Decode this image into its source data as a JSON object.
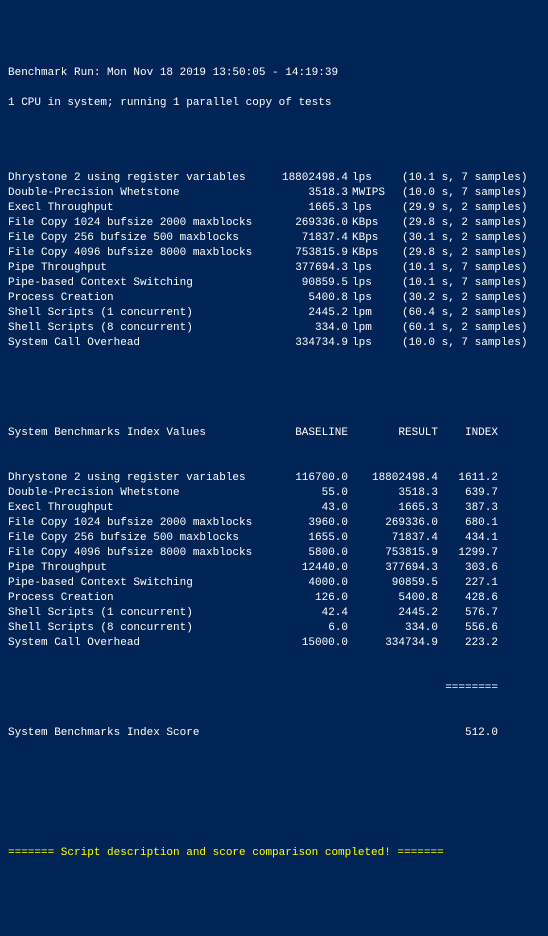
{
  "header": {
    "run_line": "Benchmark Run: Mon Nov 18 2019 13:50:05 - 14:19:39",
    "cpu_line": "1 CPU in system; running 1 parallel copy of tests"
  },
  "tests": [
    {
      "name": "Dhrystone 2 using register variables",
      "value": "18802498.4",
      "unit": "lps",
      "time": "10.1 s",
      "samples": "7 samples"
    },
    {
      "name": "Double-Precision Whetstone",
      "value": "3518.3",
      "unit": "MWIPS",
      "time": "10.0 s",
      "samples": "7 samples"
    },
    {
      "name": "Execl Throughput",
      "value": "1665.3",
      "unit": "lps",
      "time": "29.9 s",
      "samples": "2 samples"
    },
    {
      "name": "File Copy 1024 bufsize 2000 maxblocks",
      "value": "269336.0",
      "unit": "KBps",
      "time": "29.8 s",
      "samples": "2 samples"
    },
    {
      "name": "File Copy 256 bufsize 500 maxblocks",
      "value": "71837.4",
      "unit": "KBps",
      "time": "30.1 s",
      "samples": "2 samples"
    },
    {
      "name": "File Copy 4096 bufsize 8000 maxblocks",
      "value": "753815.9",
      "unit": "KBps",
      "time": "29.8 s",
      "samples": "2 samples"
    },
    {
      "name": "Pipe Throughput",
      "value": "377694.3",
      "unit": "lps",
      "time": "10.1 s",
      "samples": "7 samples"
    },
    {
      "name": "Pipe-based Context Switching",
      "value": "90859.5",
      "unit": "lps",
      "time": "10.1 s",
      "samples": "7 samples"
    },
    {
      "name": "Process Creation",
      "value": "5400.8",
      "unit": "lps",
      "time": "30.2 s",
      "samples": "2 samples"
    },
    {
      "name": "Shell Scripts (1 concurrent)",
      "value": "2445.2",
      "unit": "lpm",
      "time": "60.4 s",
      "samples": "2 samples"
    },
    {
      "name": "Shell Scripts (8 concurrent)",
      "value": "334.0",
      "unit": "lpm",
      "time": "60.1 s",
      "samples": "2 samples"
    },
    {
      "name": "System Call Overhead",
      "value": "334734.9",
      "unit": "lps",
      "time": "10.0 s",
      "samples": "7 samples"
    }
  ],
  "index_header": {
    "title": "System Benchmarks Index Values",
    "baseline": "BASELINE",
    "result": "RESULT",
    "index": "INDEX"
  },
  "indices": [
    {
      "name": "Dhrystone 2 using register variables",
      "baseline": "116700.0",
      "result": "18802498.4",
      "index": "1611.2"
    },
    {
      "name": "Double-Precision Whetstone",
      "baseline": "55.0",
      "result": "3518.3",
      "index": "639.7"
    },
    {
      "name": "Execl Throughput",
      "baseline": "43.0",
      "result": "1665.3",
      "index": "387.3"
    },
    {
      "name": "File Copy 1024 bufsize 2000 maxblocks",
      "baseline": "3960.0",
      "result": "269336.0",
      "index": "680.1"
    },
    {
      "name": "File Copy 256 bufsize 500 maxblocks",
      "baseline": "1655.0",
      "result": "71837.4",
      "index": "434.1"
    },
    {
      "name": "File Copy 4096 bufsize 8000 maxblocks",
      "baseline": "5800.0",
      "result": "753815.9",
      "index": "1299.7"
    },
    {
      "name": "Pipe Throughput",
      "baseline": "12440.0",
      "result": "377694.3",
      "index": "303.6"
    },
    {
      "name": "Pipe-based Context Switching",
      "baseline": "4000.0",
      "result": "90859.5",
      "index": "227.1"
    },
    {
      "name": "Process Creation",
      "baseline": "126.0",
      "result": "5400.8",
      "index": "428.6"
    },
    {
      "name": "Shell Scripts (1 concurrent)",
      "baseline": "42.4",
      "result": "2445.2",
      "index": "576.7"
    },
    {
      "name": "Shell Scripts (8 concurrent)",
      "baseline": "6.0",
      "result": "334.0",
      "index": "556.6"
    },
    {
      "name": "System Call Overhead",
      "baseline": "15000.0",
      "result": "334734.9",
      "index": "223.2"
    }
  ],
  "rule": "========",
  "score": {
    "label": "System Benchmarks Index Score",
    "value": "512.0"
  },
  "footer": "======= Script description and score comparison completed! ======="
}
